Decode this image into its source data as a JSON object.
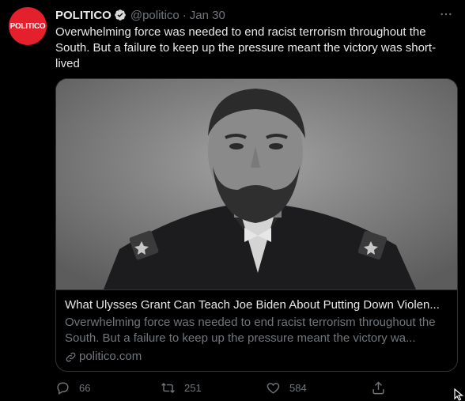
{
  "tweet": {
    "avatar_text": "POLITICO",
    "name": "POLITICO",
    "handle": "@politico",
    "separator": "·",
    "date": "Jan 30",
    "text": "Overwhelming force was needed to end racist terrorism throughout the South. But a failure to keep up the pressure meant the victory was short-lived"
  },
  "card": {
    "title": "What Ulysses Grant Can Teach Joe Biden About Putting Down Violen...",
    "description": "Overwhelming force was needed to end racist terrorism throughout the South. But a failure to keep up the pressure meant the victory wa...",
    "domain": "politico.com"
  },
  "actions": {
    "reply_count": "66",
    "retweet_count": "251",
    "like_count": "584"
  },
  "colors": {
    "avatar": "#e3202c",
    "background": "#000000",
    "muted": "#71767b",
    "text": "#e7e9ea"
  },
  "icons": [
    "verified-icon",
    "more-icon",
    "link-icon",
    "reply-icon",
    "retweet-icon",
    "like-icon",
    "share-icon",
    "cursor-icon"
  ]
}
